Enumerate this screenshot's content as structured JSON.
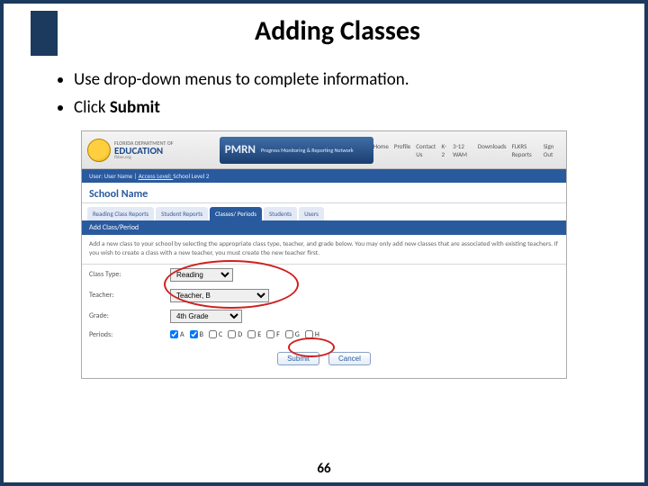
{
  "title": "Adding Classes",
  "bullets": {
    "b1": "Use drop-down menus to complete information.",
    "b2_prefix": "Click ",
    "b2_bold": "Submit"
  },
  "app": {
    "logo_top": "FLORIDA DEPARTMENT OF",
    "logo_main": "EDUCATION",
    "logo_sub": "fldoe.org",
    "pmrn_label": "PMRN",
    "pmrn_sub": "Progress Monitoring & Reporting Network",
    "nav": {
      "home": "Home",
      "profile": "Profile",
      "contact": "Contact Us",
      "k2": "K-2",
      "312wam": "3-12 WAM",
      "downloads": "Downloads",
      "flkrs": "FLKRS Reports",
      "signout": "Sign Out"
    },
    "userline_label": "User: User Name  |  ",
    "userline_access_label": "Access Level: ",
    "userline_access_value": "School Level 2",
    "school_name": "School Name",
    "tabs": {
      "t1": "Reading Class Reports",
      "t2": "Student Reports",
      "t3": "Classes/ Periods",
      "t4": "Students",
      "t5": "Users"
    },
    "subheader": "Add Class/Period",
    "instruction": "Add a new class to your school by selecting the appropriate class type, teacher, and grade below. You may only add new classes that are associated with existing teachers. If you wish to create a class with a new teacher, you must create the new teacher first.",
    "form": {
      "class_type_label": "Class Type:",
      "class_type_value": "Reading",
      "teacher_label": "Teacher:",
      "teacher_value": "Teacher, B",
      "grade_label": "Grade:",
      "grade_value": "4th Grade",
      "periods_label": "Periods:",
      "periods": [
        "A",
        "B",
        "C",
        "D",
        "E",
        "F",
        "G",
        "H"
      ]
    },
    "buttons": {
      "submit": "Submit",
      "cancel": "Cancel"
    }
  },
  "page_number": "66"
}
